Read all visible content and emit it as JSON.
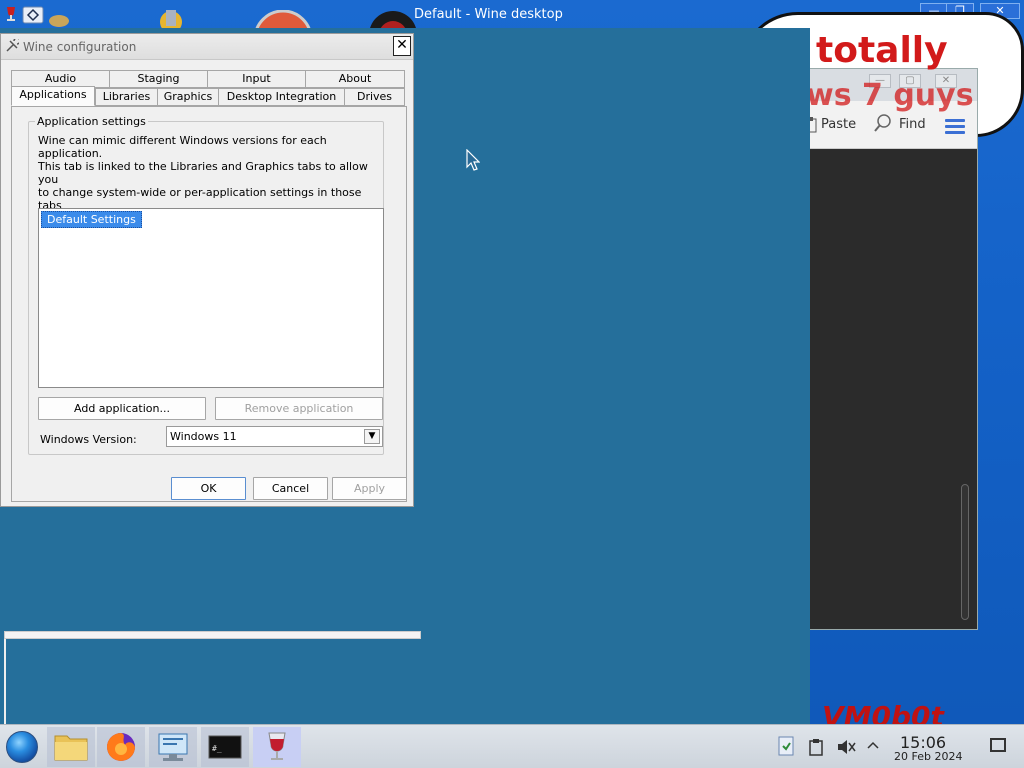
{
  "host": {
    "title": "Default - Wine desktop",
    "minimize": "—",
    "maximize": "❐",
    "close": "✕",
    "bubble_line1": "totally",
    "bubble_line2": "ws 7 guys",
    "watermark": "VM0b0t"
  },
  "editor": {
    "tools": [
      {
        "label": "Paste"
      },
      {
        "label": "Find"
      }
    ]
  },
  "winecfg": {
    "title": "Wine configuration",
    "close": "✕",
    "tabs_row1": [
      "Audio",
      "Staging",
      "Input",
      "About"
    ],
    "tabs_row2": [
      "Applications",
      "Libraries",
      "Graphics",
      "Desktop Integration",
      "Drives"
    ],
    "active_tab": "Applications",
    "group_label": "Application settings",
    "description": "Wine can mimic different Windows versions for each application.\nThis tab is linked to the Libraries and Graphics tabs to allow you\nto change system-wide or per-application settings in those tabs\nas well.",
    "app_list": [
      "Default Settings"
    ],
    "add_button": "Add application...",
    "remove_button": "Remove application",
    "winver_label": "Windows Version:",
    "winver_value": "Windows 11",
    "ok": "OK",
    "cancel": "Cancel",
    "apply": "Apply"
  },
  "taskbar": {
    "time": "15:06",
    "date": "20 Feb 2024"
  },
  "colors": {
    "wine_desktop": "#256f9b",
    "host_desktop": "#1462c8",
    "selection": "#3b8bea",
    "bubble_text": "#d21a1a"
  }
}
